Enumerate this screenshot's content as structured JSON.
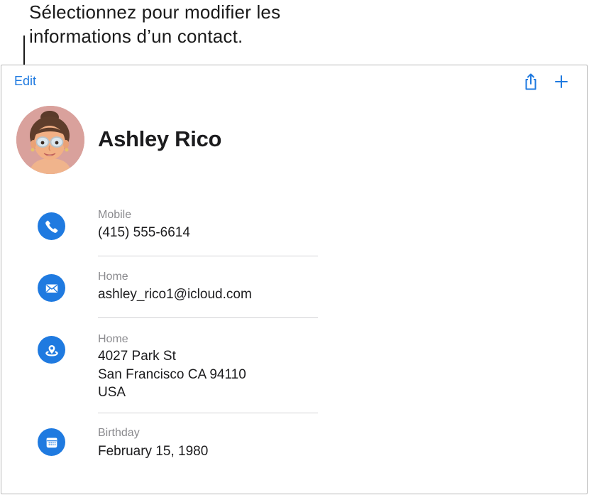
{
  "callout": {
    "line1": "Sélectionnez pour modifier les",
    "line2": "informations d’un contact."
  },
  "toolbar": {
    "edit_label": "Edit"
  },
  "icons": {
    "share": "share-icon",
    "add": "plus-icon",
    "phone": "phone-icon",
    "mail": "envelope-icon",
    "location": "location-pin-icon",
    "calendar": "calendar-icon"
  },
  "colors": {
    "accent": "#1f7ae0",
    "avatar_bg": "#d9a19c"
  },
  "contact": {
    "name": "Ashley Rico",
    "fields": [
      {
        "label": "Mobile",
        "value": "(415) 555-6614"
      },
      {
        "label": "Home",
        "value": "ashley_rico1@icloud.com"
      },
      {
        "label": "Home",
        "value": "4027 Park St\nSan Francisco CA 94110\nUSA"
      },
      {
        "label": "Birthday",
        "value": "February 15, 1980"
      }
    ]
  }
}
